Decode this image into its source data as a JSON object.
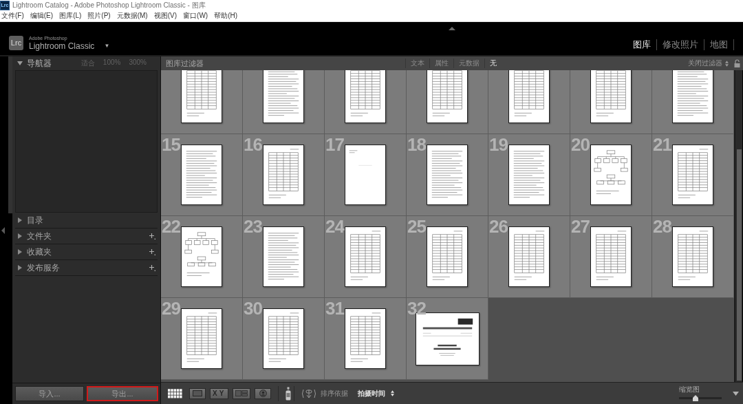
{
  "title_bar": {
    "icon_text": "Lrc",
    "title": "Lightroom Catalog - Adobe Photoshop Lightroom Classic - 图库"
  },
  "menu": [
    "文件(F)",
    "编辑(E)",
    "图库(L)",
    "照片(P)",
    "元数据(M)",
    "视图(V)",
    "窗口(W)",
    "帮助(H)"
  ],
  "header": {
    "logo_text": "Lrc",
    "brand_small": "Adobe Photoshop",
    "brand": "Lightroom Classic",
    "brand_caret": "▼",
    "modules": [
      {
        "label": "图库",
        "selected": true
      },
      {
        "label": "修改照片",
        "selected": false
      },
      {
        "label": "地图",
        "selected": false
      }
    ]
  },
  "left_panel": {
    "navigator": {
      "title": "导航器",
      "expanded": true,
      "zoom_options": [
        "适合",
        "100%",
        "300%"
      ]
    },
    "sections": [
      {
        "title": "目录",
        "expanded": false,
        "add_button": false
      },
      {
        "title": "文件夹",
        "expanded": false,
        "add_button": true
      },
      {
        "title": "收藏夹",
        "expanded": false,
        "add_button": true
      },
      {
        "title": "发布服务",
        "expanded": false,
        "add_button": true
      }
    ],
    "buttons": [
      {
        "label": "导入...",
        "highlighted": false
      },
      {
        "label": "导出...",
        "highlighted": true
      }
    ]
  },
  "filter_bar": {
    "title": "图库过滤器",
    "filters": [
      {
        "label": "文本",
        "selected": false
      },
      {
        "label": "属性",
        "selected": false
      },
      {
        "label": "元数据",
        "selected": false
      },
      {
        "label": "无",
        "selected": true
      }
    ],
    "preset": "关闭过滤器"
  },
  "grid": {
    "cells": [
      {
        "kind": "table"
      },
      {
        "kind": "text"
      },
      {
        "kind": "table"
      },
      {
        "kind": "table"
      },
      {
        "kind": "table"
      },
      {
        "kind": "table"
      },
      {
        "kind": "text"
      },
      {
        "number": "15",
        "kind": "text"
      },
      {
        "number": "16",
        "kind": "table"
      },
      {
        "number": "17",
        "kind": "blank"
      },
      {
        "number": "18",
        "kind": "text"
      },
      {
        "number": "19",
        "kind": "text"
      },
      {
        "number": "20",
        "kind": "diagram"
      },
      {
        "number": "21",
        "kind": "table"
      },
      {
        "number": "22",
        "kind": "diagram"
      },
      {
        "number": "23",
        "kind": "text"
      },
      {
        "number": "24",
        "kind": "table"
      },
      {
        "number": "25",
        "kind": "table"
      },
      {
        "number": "26",
        "kind": "table"
      },
      {
        "number": "27",
        "kind": "table"
      },
      {
        "number": "28",
        "kind": "table"
      },
      {
        "number": "29",
        "kind": "table"
      },
      {
        "number": "30",
        "kind": "table"
      },
      {
        "number": "31",
        "kind": "table"
      },
      {
        "number": "32",
        "kind": "cover"
      }
    ]
  },
  "toolbar": {
    "view_modes": [
      {
        "kind": "grid",
        "selected": true
      },
      {
        "kind": "loupe",
        "selected": false
      },
      {
        "kind": "compare",
        "selected": false,
        "label": "XY"
      },
      {
        "kind": "survey",
        "selected": false
      },
      {
        "kind": "people",
        "selected": false
      }
    ],
    "sort_label": "排序依据",
    "sort_value": "拍摄时间",
    "thumbnail_label": "缩览图",
    "thumbnail_size": {
      "level": 0.37
    }
  }
}
